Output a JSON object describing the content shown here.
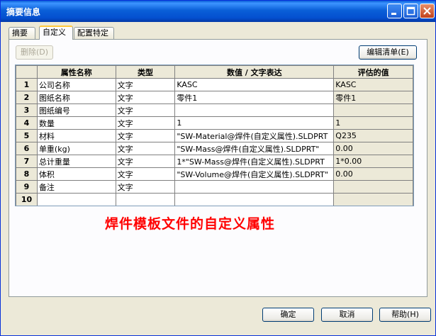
{
  "window": {
    "title": "摘要信息"
  },
  "tabs": [
    {
      "label": "摘要"
    },
    {
      "label": "自定义"
    },
    {
      "label": "配置特定"
    }
  ],
  "toolbar": {
    "delete_label": "删除(D)",
    "edit_list_label": "编辑清单(E)"
  },
  "table": {
    "headers": [
      "",
      "属性名称",
      "类型",
      "数值 / 文字表达",
      "评估的值"
    ],
    "rows": [
      {
        "num": "1",
        "name": "公司名称",
        "type": "文字",
        "value": "KASC",
        "evaluated": "KASC"
      },
      {
        "num": "2",
        "name": "图纸名称",
        "type": "文字",
        "value": "零件1",
        "evaluated": "零件1"
      },
      {
        "num": "3",
        "name": "图纸编号",
        "type": "文字",
        "value": "",
        "evaluated": ""
      },
      {
        "num": "4",
        "name": "数量",
        "type": "文字",
        "value": "1",
        "evaluated": "1"
      },
      {
        "num": "5",
        "name": "材料",
        "type": "文字",
        "value": "\"SW-Material@焊件(自定义属性).SLDPRT",
        "evaluated": "Q235"
      },
      {
        "num": "6",
        "name": "单重(kg)",
        "type": "文字",
        "value": "\"SW-Mass@焊件(自定义属性).SLDPRT\"",
        "evaluated": "0.00"
      },
      {
        "num": "7",
        "name": "总计重量",
        "type": "文字",
        "value": "1*\"SW-Mass@焊件(自定义属性).SLDPRT",
        "evaluated": "1*0.00"
      },
      {
        "num": "8",
        "name": "体积",
        "type": "文字",
        "value": "\"SW-Volume@焊件(自定义属性).SLDPRT\"",
        "evaluated": "0.00"
      },
      {
        "num": "9",
        "name": "备注",
        "type": "文字",
        "value": "",
        "evaluated": ""
      },
      {
        "num": "10",
        "name": "",
        "type": "",
        "value": "",
        "evaluated": ""
      }
    ]
  },
  "annotation": "焊件模板文件的自定义属性",
  "footer": {
    "ok_label": "确定",
    "cancel_label": "取消",
    "help_label": "帮助(H)"
  },
  "colors": {
    "titlebar": "#0a5fd8",
    "annotation": "#ff0000",
    "dialog_bg": "#ece9d8"
  },
  "icons": [
    "minimize-icon",
    "maximize-icon",
    "close-icon"
  ]
}
